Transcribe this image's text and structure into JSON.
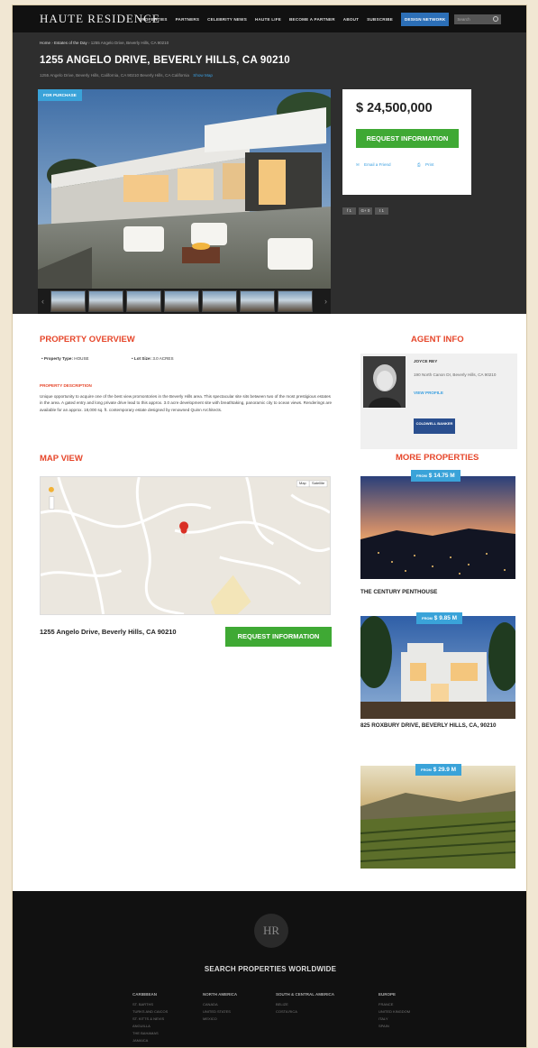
{
  "header": {
    "logo": "HAUTE RESIDENCE",
    "nav": [
      "PROPERTIES",
      "PARTNERS",
      "CELEBRITY NEWS",
      "HAUTE LIFE",
      "BECOME A PARTNER",
      "ABOUT",
      "SUBSCRIBE"
    ],
    "design_network": "DESIGN NETWORK",
    "search_placeholder": "Search"
  },
  "breadcrumb": {
    "home": "Home",
    "parent": "Estates of the Day",
    "current": "1255 Angelo Drive, Beverly Hills, CA 90210"
  },
  "property": {
    "title": "1255 ANGELO DRIVE, BEVERLY HILLS, CA 90210",
    "address": "1255 Angelo Drive, Beverly Hills, California, CA 90210 Beverly Hills, CA California",
    "show_map": "Show Map",
    "badge": "FOR PURCHASE",
    "price": "$ 24,500,000",
    "request_label": "REQUEST INFORMATION",
    "email_friend": "Email a Friend",
    "print": "Print",
    "share": [
      "f 1",
      "G+ 0",
      "t 1"
    ],
    "gallery_count": 7
  },
  "overview": {
    "heading": "PROPERTY OVERVIEW",
    "type_label": "Property Type:",
    "type_value": "HOUSE",
    "lot_label": "Lot Size:",
    "lot_value": "3.0 ACRES",
    "desc_title": "PROPERTY DESCRIPTION",
    "description": "Unique opportunity to acquire one of the best view promontories in the Beverly Hills area. This spectacular site sits between two of the most prestigious estates in the area. A gated entry and long private drive lead to this approx. 3.0 acre development site with breathtaking, panoramic city to ocean views. Renderings are available for an approx. 18,000 sq. ft. contemporary estate designed by renowned Quinn Architects."
  },
  "map": {
    "heading": "MAP VIEW",
    "map_btn": "Map",
    "sat_btn": "Satellite",
    "address": "1255 Angelo Drive, Beverly Hills, CA 90210",
    "request_label": "REQUEST INFORMATION"
  },
  "agent": {
    "heading": "AGENT INFO",
    "name": "JOYCE REY",
    "address": "190 North Canon Dr, Beverly Hills, CA 90210",
    "view_profile": "VIEW PROFILE",
    "logo_text": "COLDWELL BANKER"
  },
  "more": {
    "heading": "MORE PROPERTIES",
    "items": [
      {
        "price_prefix": "FROM",
        "price": "$ 14.75 M",
        "name": "THE CENTURY PENTHOUSE"
      },
      {
        "price_prefix": "FROM",
        "price": "$ 9.85 M",
        "name": "825 ROXBURY DRIVE, BEVERLY HILLS, CA, 90210"
      },
      {
        "price_prefix": "FROM",
        "price": "$ 29.9 M",
        "name": ""
      }
    ]
  },
  "footer": {
    "logo": "HR",
    "heading": "SEARCH PROPERTIES WORLDWIDE",
    "columns": [
      {
        "title": "CARIBBEAN",
        "items": [
          "ST. BARTHS",
          "TURKS AND CAICOS",
          "ST. KITTS & NEVIS",
          "ANGUILLA",
          "THE BAHAMAS",
          "JAMAICA"
        ]
      },
      {
        "title": "NORTH AMERICA",
        "items": [
          "CANADA",
          "UNITED STATES",
          "MEXICO"
        ]
      },
      {
        "title": "SOUTH & CENTRAL AMERICA",
        "items": [
          "BELIZE",
          "COSTA RICA"
        ]
      },
      {
        "title": "EUROPE",
        "items": [
          "FRANCE",
          "UNITED KINGDOM",
          "ITALY",
          "SPAIN"
        ]
      }
    ]
  }
}
